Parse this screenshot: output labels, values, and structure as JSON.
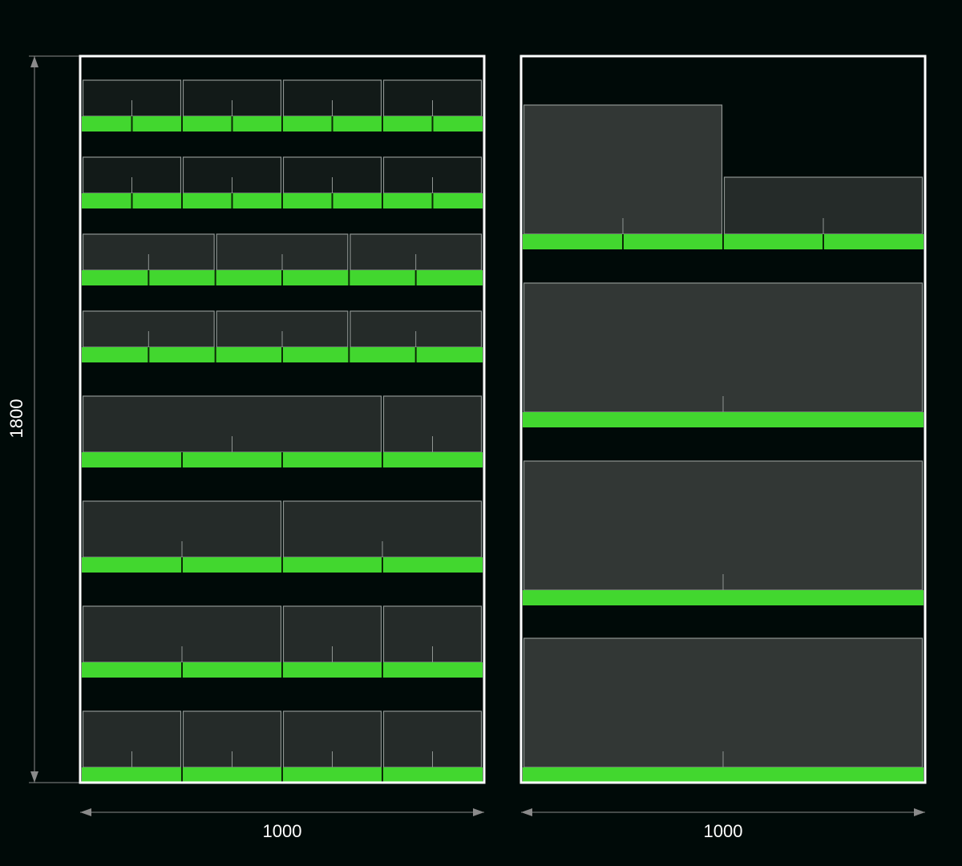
{
  "dimensions": {
    "height_label": "1800",
    "left_width_label": "1000",
    "right_width_label": "1000"
  },
  "colors": {
    "background": "#000a08",
    "frame": "#ffffff",
    "shelf": "#42d72f",
    "shelf_divider": "#0b2a06",
    "item_border": "#8f9592",
    "item_fill_dark": "#121a18",
    "item_fill_mid": "#252b29",
    "item_fill_light": "#323735",
    "dimension_line": "#8a8a8a"
  },
  "left_rack": {
    "shelves": [
      {
        "sections": 8,
        "item_widths": [
          1,
          1,
          1,
          1
        ]
      },
      {
        "sections": 8,
        "item_widths": [
          1,
          1,
          1,
          1
        ]
      },
      {
        "sections": 6,
        "item_widths": [
          1,
          1,
          1
        ]
      },
      {
        "sections": 6,
        "item_widths": [
          1,
          1,
          1
        ]
      },
      {
        "sections": 4,
        "item_widths": [
          3,
          1
        ]
      },
      {
        "sections": 4,
        "item_widths": [
          1,
          1
        ]
      },
      {
        "sections": 4,
        "item_widths": [
          2,
          1,
          1
        ]
      },
      {
        "sections": 4,
        "item_widths": [
          1,
          1,
          1,
          1
        ]
      }
    ]
  },
  "right_rack": {
    "shelves": [
      {
        "sections": 4,
        "item_widths": [
          1,
          1
        ]
      },
      {
        "sections": 1,
        "item_widths": [
          1
        ]
      },
      {
        "sections": 1,
        "item_widths": [
          1
        ]
      },
      {
        "sections": 1,
        "item_widths": [
          1
        ]
      }
    ]
  }
}
